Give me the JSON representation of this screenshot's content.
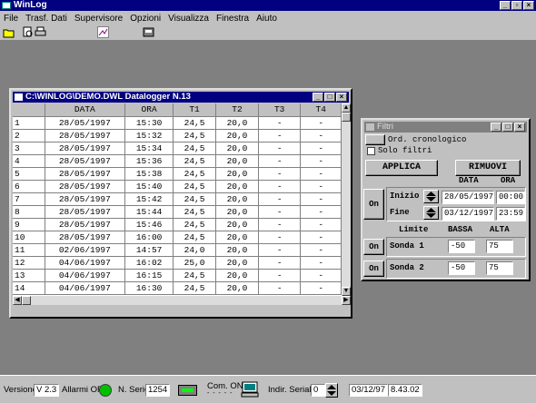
{
  "app": {
    "title": "WinLog"
  },
  "menu": [
    "File",
    "Trasf. Dati",
    "Supervisore",
    "Opzioni",
    "Visualizza",
    "Finestra",
    "Aiuto"
  ],
  "datalog": {
    "title": "C:\\WINLOG\\DEMO.DWL Datalogger N.13",
    "columns": [
      "",
      "DATA",
      "ORA",
      "T1",
      "T2",
      "T3",
      "T4"
    ],
    "rows": [
      [
        "1",
        "28/05/1997",
        "15:30",
        "24,5",
        "20,0",
        "-",
        "-"
      ],
      [
        "2",
        "28/05/1997",
        "15:32",
        "24,5",
        "20,0",
        "-",
        "-"
      ],
      [
        "3",
        "28/05/1997",
        "15:34",
        "24,5",
        "20,0",
        "-",
        "-"
      ],
      [
        "4",
        "28/05/1997",
        "15:36",
        "24,5",
        "20,0",
        "-",
        "-"
      ],
      [
        "5",
        "28/05/1997",
        "15:38",
        "24,5",
        "20,0",
        "-",
        "-"
      ],
      [
        "6",
        "28/05/1997",
        "15:40",
        "24,5",
        "20,0",
        "-",
        "-"
      ],
      [
        "7",
        "28/05/1997",
        "15:42",
        "24,5",
        "20,0",
        "-",
        "-"
      ],
      [
        "8",
        "28/05/1997",
        "15:44",
        "24,5",
        "20,0",
        "-",
        "-"
      ],
      [
        "9",
        "28/05/1997",
        "15:46",
        "24,5",
        "20,0",
        "-",
        "-"
      ],
      [
        "10",
        "28/05/1997",
        "16:00",
        "24,5",
        "20,0",
        "-",
        "-"
      ],
      [
        "11",
        "02/06/1997",
        "14:57",
        "24,0",
        "20,0",
        "-",
        "-"
      ],
      [
        "12",
        "04/06/1997",
        "16:02",
        "25,0",
        "20,0",
        "-",
        "-"
      ],
      [
        "13",
        "04/06/1997",
        "16:15",
        "24,5",
        "20,0",
        "-",
        "-"
      ],
      [
        "14",
        "04/06/1997",
        "16:30",
        "24,5",
        "20,0",
        "-",
        "-"
      ]
    ]
  },
  "filtri": {
    "title": "Filtri",
    "ord_label": "Ord. cronologico",
    "solo_label": "Solo filtri",
    "applica": "APPLICA",
    "rimuovi": "RIMUOVI",
    "col_data": "DATA",
    "col_ora": "ORA",
    "on": "On",
    "inizio_label": "Inizio",
    "fine_label": "Fine",
    "inizio_data": "28/05/1997",
    "inizio_ora": "00:00",
    "fine_data": "03/12/1997",
    "fine_ora": "23:59",
    "limite": "Limite",
    "bassa": "BASSA",
    "alta": "ALTA",
    "sonda1": "Sonda 1",
    "sonda1_bassa": "-50",
    "sonda1_alta": "75",
    "sonda2": "Sonda 2",
    "sonda2_bassa": "-50",
    "sonda2_alta": "75"
  },
  "status": {
    "versione_label": "Versione",
    "versione": "V 2.3",
    "allarmi": "Allarmi OFF",
    "nserie_label": "N. Serie",
    "nserie": "1254",
    "com": "Com. ON",
    "indir_label": "Indir. Seriale",
    "indir": "0",
    "date": "03/12/97",
    "time": "8.43.02"
  },
  "colors": {
    "titlebar": "#000080",
    "face": "#c0c0c0",
    "desktop": "#808080",
    "alarm_led": "#00c000"
  }
}
